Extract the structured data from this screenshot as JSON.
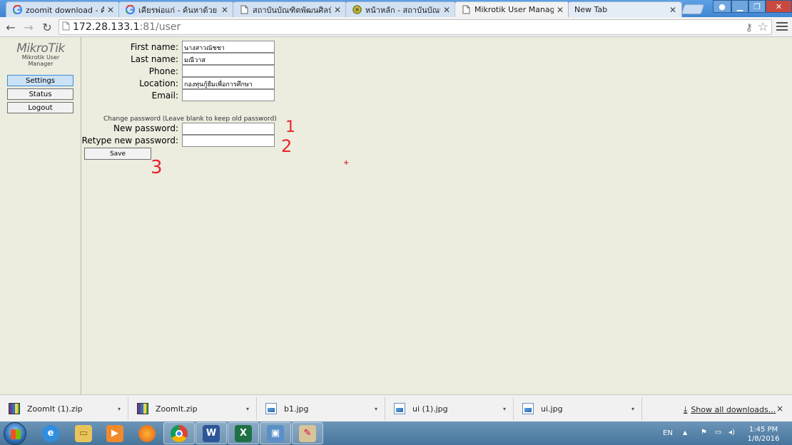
{
  "browser": {
    "tabs": [
      {
        "title": "zoomit download - ค้นห",
        "icon": "google-icon",
        "active": false
      },
      {
        "title": "เคียรพ่อแก่ - ค้นหาด้วย Goo",
        "icon": "google-icon",
        "active": false
      },
      {
        "title": "สถาบันบัณฑิตพัฒนศิลป์ เว็บ",
        "icon": "page-icon",
        "active": false
      },
      {
        "title": "หน้าหลัก - สถาบันบัณฑิตพั",
        "icon": "site-icon",
        "active": false
      },
      {
        "title": "Mikrotik User Manager",
        "icon": "page-icon",
        "active": true
      },
      {
        "title": "New Tab",
        "icon": "",
        "active": false
      }
    ],
    "url_host": "172.28.133.1",
    "url_rest": ":81/user"
  },
  "sidebar": {
    "logo_text": "MikroTik",
    "logo_sub": "Mikrotik User Manager",
    "buttons": [
      "Settings",
      "Status",
      "Logout"
    ]
  },
  "form": {
    "first_name_label": "First name:",
    "first_name_value": "นางสาวณัชชา",
    "last_name_label": "Last name:",
    "last_name_value": "มณีวาส",
    "phone_label": "Phone:",
    "phone_value": "",
    "location_label": "Location:",
    "location_value": "กองทุนกู้ยืมเพื่อการศึกษา",
    "email_label": "Email:",
    "email_value": "",
    "password_hint": "Change password (Leave blank to keep old password)",
    "new_password_label": "New password:",
    "retype_password_label": "Retype new password:",
    "save_label": "Save"
  },
  "annotations": [
    "1",
    "2",
    "3"
  ],
  "annotation_color": "#e8262a",
  "cursor_mark": "+",
  "downloads": {
    "items": [
      "ZoomIt (1).zip",
      "ZoomIt.zip",
      "b1.jpg",
      "ui (1).jpg",
      "ui.jpg"
    ],
    "show_all": "Show all downloads...",
    "close": "×"
  },
  "taskbar": {
    "apps": [
      "ie-icon",
      "explorer-icon",
      "media-player-icon",
      "firefox-icon",
      "chrome-icon",
      "word-icon",
      "excel-icon",
      "remote-desktop-icon",
      "paint-icon"
    ],
    "language": "EN",
    "time": "1:45 PM",
    "date": "1/8/2016"
  }
}
